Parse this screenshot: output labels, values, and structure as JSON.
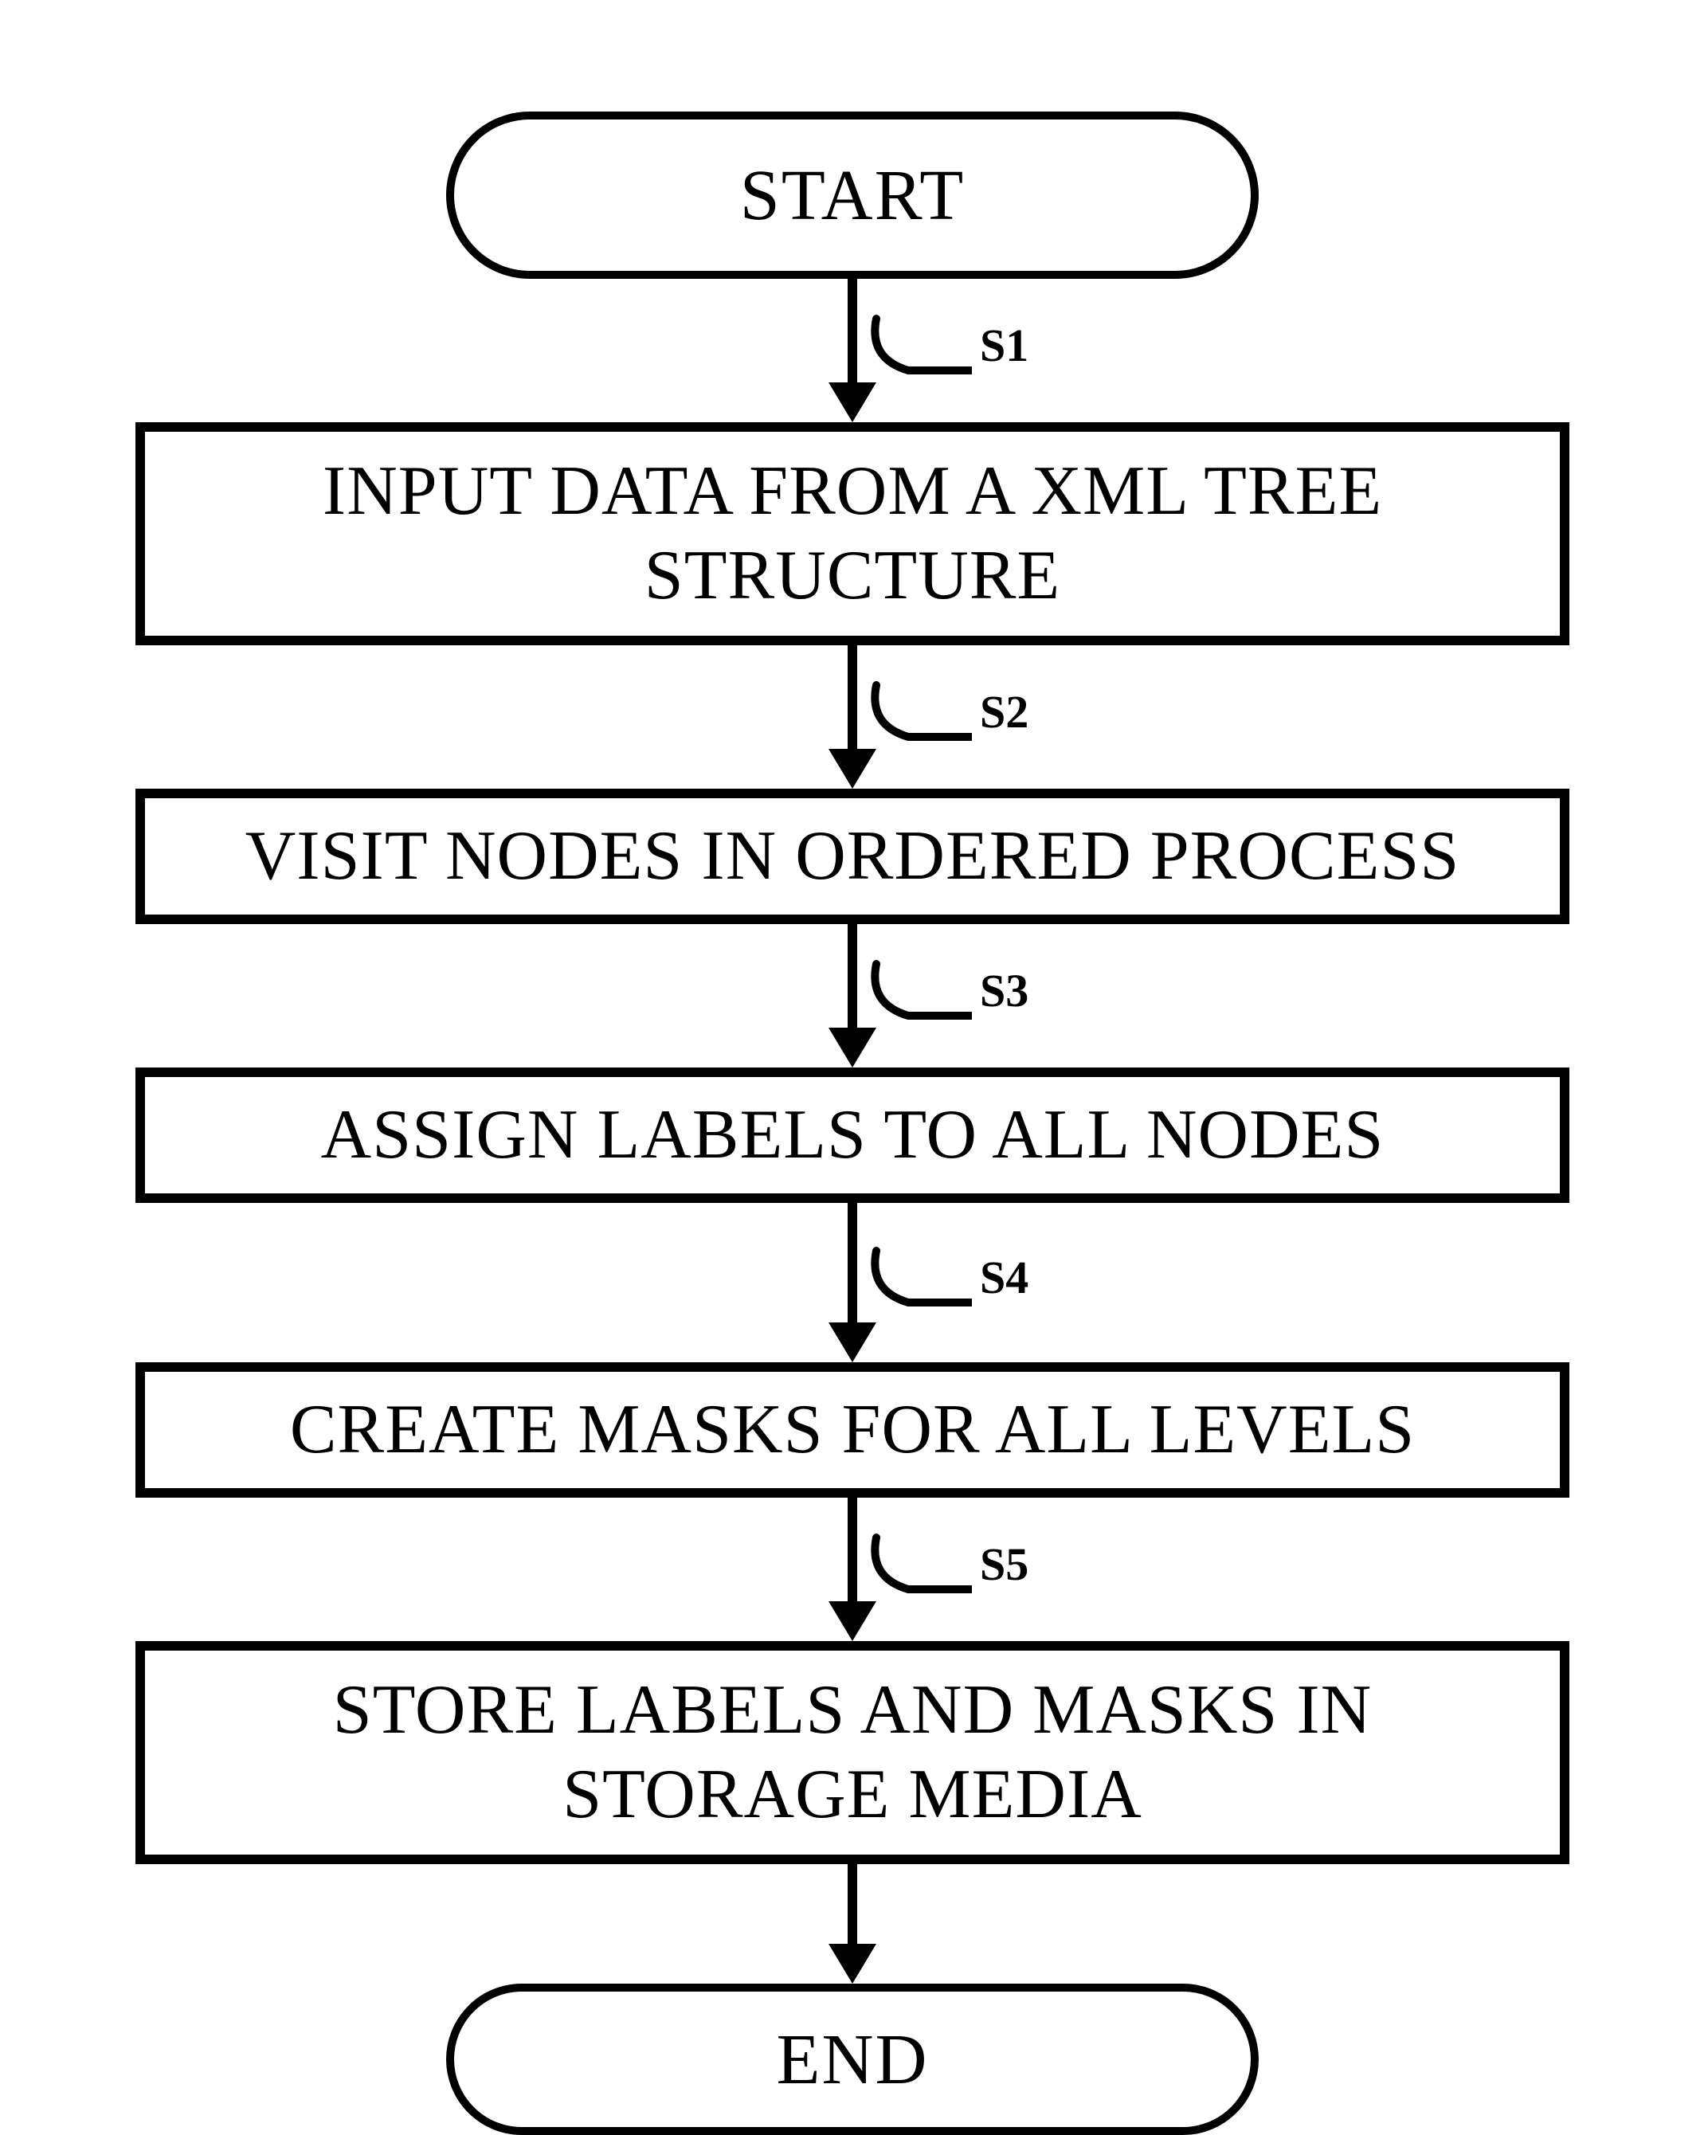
{
  "nodes": {
    "start": "START",
    "s1": "INPUT DATA FROM A XML TREE STRUCTURE",
    "s2": "VISIT NODES IN ORDERED PROCESS",
    "s3": "ASSIGN LABELS TO ALL NODES",
    "s4": "CREATE MASKS FOR ALL LEVELS",
    "s5": "STORE LABELS AND MASKS IN STORAGE MEDIA",
    "end": "END"
  },
  "edge_labels": {
    "e1": "S1",
    "e2": "S2",
    "e3": "S3",
    "e4": "S4",
    "e5": "S5"
  }
}
